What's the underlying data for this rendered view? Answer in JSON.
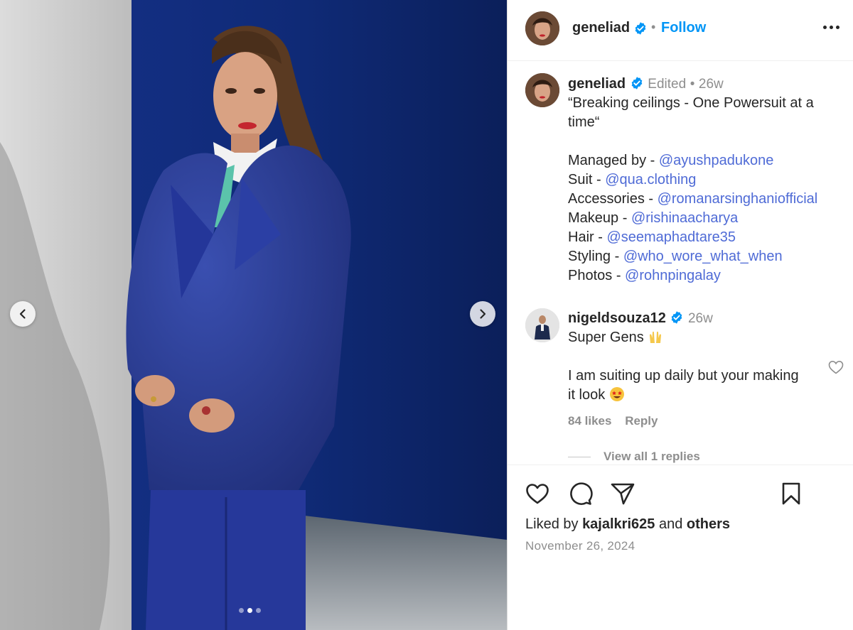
{
  "post": {
    "author": "geneliad",
    "follow_label": "Follow",
    "separator": "•",
    "carousel": {
      "total_slides": 3,
      "active_slide": 2
    }
  },
  "caption": {
    "author": "geneliad",
    "edited_label": "Edited",
    "separator": "•",
    "age": "26w",
    "title_line1": "“Breaking ceilings - One Powersuit at a",
    "title_line2": "time“",
    "credits": [
      {
        "label": "Managed by - ",
        "mention": "@ayushpadukone"
      },
      {
        "label": "Suit - ",
        "mention": "@qua.clothing"
      },
      {
        "label": "Accessories - ",
        "mention": "@romanarsinghaniofficial"
      },
      {
        "label": "Makeup - ",
        "mention": "@rishinaacharya"
      },
      {
        "label": "Hair - ",
        "mention": "@seemaphadtare35"
      },
      {
        "label": "Styling - ",
        "mention": "@who_wore_what_when"
      },
      {
        "label": "Photos - ",
        "mention": "@rohnpingalay"
      }
    ]
  },
  "comment": {
    "author": "nigeldsouza12",
    "age": "26w",
    "line1": "Super Gens",
    "line2": "I am suiting up daily but your making",
    "line3": "it look",
    "likes": "84 likes",
    "reply_label": "Reply",
    "view_replies": "View all 1 replies"
  },
  "footer": {
    "liked_prefix": "Liked by",
    "liked_user": "kajalkri625",
    "liked_and": "and",
    "liked_others": "others",
    "date": "November 26, 2024"
  },
  "colors": {
    "link": "#0095f6",
    "mention": "#4f6bd6",
    "verified": "#0095f6",
    "muted": "#8e8e8e",
    "backdrop": "#0f2b78",
    "suit": "#2a3d96"
  },
  "icons": {
    "verified": "verified-badge-icon",
    "more": "more-options-icon",
    "prev": "chevron-left-icon",
    "next": "chevron-right-icon",
    "like": "heart-icon",
    "comment": "comment-bubble-icon",
    "share": "paper-plane-icon",
    "save": "bookmark-icon"
  }
}
